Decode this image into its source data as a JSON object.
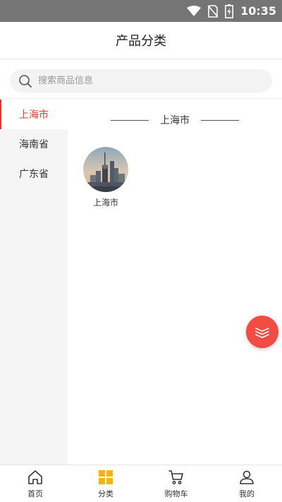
{
  "status_bar": {
    "time": "10:35",
    "icons": [
      "wifi-icon",
      "no-sim-icon",
      "battery-charging-icon"
    ]
  },
  "header": {
    "title": "产品分类"
  },
  "search": {
    "placeholder": "搜索商品信息",
    "icon": "search-icon"
  },
  "sidebar": {
    "items": [
      {
        "label": "上海市",
        "active": true
      },
      {
        "label": "海南省",
        "active": false
      },
      {
        "label": "广东省",
        "active": false
      }
    ]
  },
  "content": {
    "section_title": "上海市",
    "cities": [
      {
        "label": "上海市",
        "image": "shanghai-skyline-thumbnail"
      }
    ]
  },
  "fab": {
    "icon": "layers-icon"
  },
  "tab_bar": {
    "tabs": [
      {
        "label": "首页",
        "icon": "home-icon",
        "active": false
      },
      {
        "label": "分类",
        "icon": "category-grid-icon",
        "active": true
      },
      {
        "label": "购物车",
        "icon": "cart-icon",
        "active": false
      },
      {
        "label": "我的",
        "icon": "user-icon",
        "active": false
      }
    ]
  },
  "colors": {
    "accent": "#e03a32",
    "fab": "#f14b42",
    "active_tab": "#f5b400",
    "status_bar": "#757575"
  }
}
